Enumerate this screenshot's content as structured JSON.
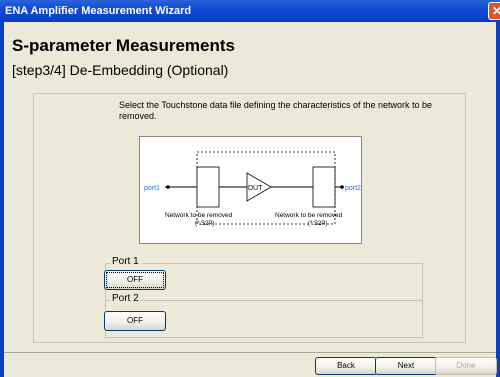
{
  "window": {
    "title": "ENA Amplifier Measurement Wizard",
    "close_label": "✕"
  },
  "header": {
    "title": "S-parameter Measurements",
    "step": "[step3/4] De-Embedding (Optional)"
  },
  "instruction": "Select the Touchstone data file defining the characteristics of the network to be removed.",
  "diagram": {
    "port1": "port1",
    "port2": "port2",
    "dut": "DUT",
    "left_label": "Network to be removed",
    "left_ext": "(*.S2P)",
    "right_label": "Network to be removed",
    "right_ext": "(*.S2P)"
  },
  "ports": [
    {
      "label": "Port 1",
      "button": "OFF"
    },
    {
      "label": "Port 2",
      "button": "OFF"
    }
  ],
  "footer": {
    "back": "Back",
    "next": "Next",
    "done": "Done"
  }
}
